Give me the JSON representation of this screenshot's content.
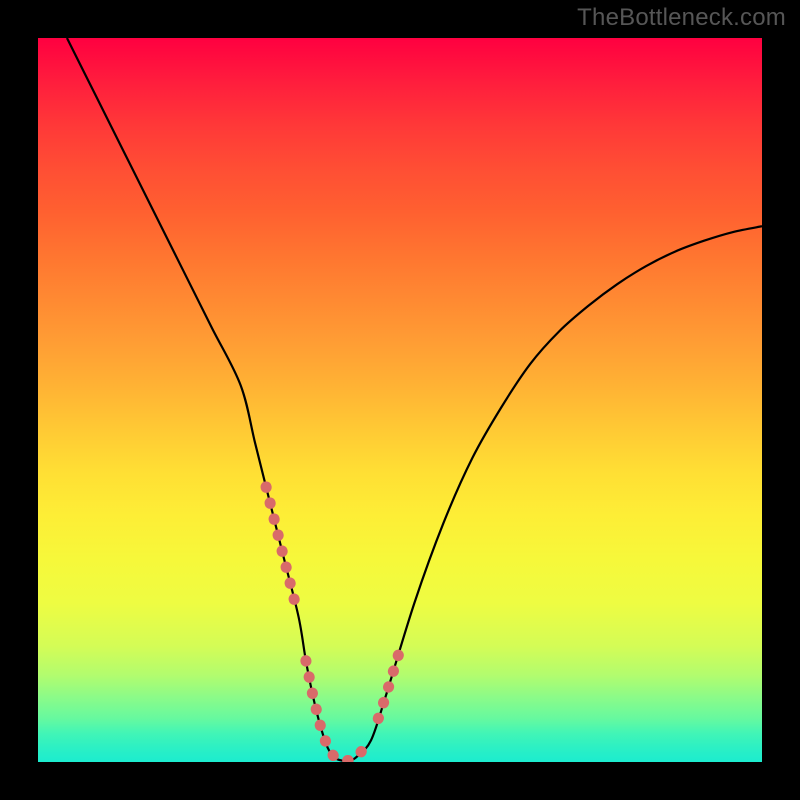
{
  "watermark": "TheBottleneck.com",
  "colors": {
    "page_bg": "#000000",
    "curve": "#000000",
    "highlight": "#d96a6a",
    "gradient_top": "#ff0040",
    "gradient_bottom": "#1ceccf"
  },
  "chart_data": {
    "type": "line",
    "title": "",
    "xlabel": "",
    "ylabel": "",
    "xlim": [
      0,
      100
    ],
    "ylim": [
      0,
      100
    ],
    "grid": false,
    "legend": false,
    "background_scale": "gradient red(top)→yellow→green(bottom), lower is better",
    "x": [
      4,
      8,
      12,
      16,
      20,
      24,
      28,
      30,
      32,
      34,
      36,
      37,
      38,
      39,
      40,
      41,
      42,
      43,
      44,
      46,
      48,
      52,
      56,
      60,
      64,
      68,
      72,
      76,
      80,
      84,
      88,
      92,
      96,
      100
    ],
    "values": [
      100,
      92,
      84,
      76,
      68,
      60,
      52,
      44,
      36,
      28,
      20,
      14,
      9,
      5,
      2,
      0.6,
      0.2,
      0.2,
      0.7,
      3,
      9,
      22,
      33,
      42,
      49,
      55,
      59.5,
      63,
      66,
      68.5,
      70.5,
      72,
      73.2,
      74
    ],
    "series": [
      {
        "name": "bottleneck-curve",
        "x": [
          4,
          8,
          12,
          16,
          20,
          24,
          28,
          30,
          32,
          34,
          36,
          37,
          38,
          39,
          40,
          41,
          42,
          43,
          44,
          46,
          48,
          52,
          56,
          60,
          64,
          68,
          72,
          76,
          80,
          84,
          88,
          92,
          96,
          100
        ],
        "y": [
          100,
          92,
          84,
          76,
          68,
          60,
          52,
          44,
          36,
          28,
          20,
          14,
          9,
          5,
          2,
          0.6,
          0.2,
          0.2,
          0.7,
          3,
          9,
          22,
          33,
          42,
          49,
          55,
          59.5,
          63,
          66,
          68.5,
          70.5,
          72,
          73.2,
          74
        ]
      }
    ],
    "highlight_segments": {
      "description": "dotted salmon segments marking near-minimum region on the curve",
      "left_descent": {
        "x_range": [
          31.5,
          35.5
        ],
        "y_range": [
          32,
          10
        ]
      },
      "valley_floor": {
        "x_range": [
          37,
          45
        ],
        "y_range": [
          3,
          3
        ]
      },
      "right_ascent": {
        "x_range": [
          47,
          50
        ],
        "y_range": [
          10,
          18
        ]
      }
    },
    "minimum": {
      "x": 42,
      "y": 0.2
    }
  }
}
